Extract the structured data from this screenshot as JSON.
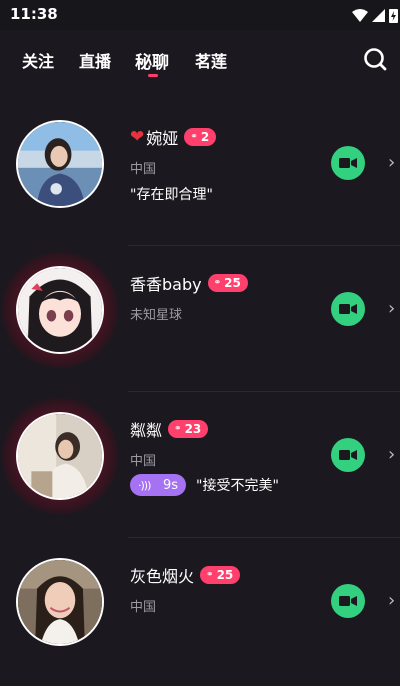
{
  "status_bar": {
    "time": "11:38",
    "icons": [
      "wifi-icon",
      "signal-icon",
      "battery-charging-icon"
    ]
  },
  "tabs": [
    {
      "label": "关注",
      "active": false
    },
    {
      "label": "直播",
      "active": false
    },
    {
      "label": "秘聊",
      "active": true
    },
    {
      "label": "茗莲",
      "active": false
    }
  ],
  "accent_color": "#ff3c6f",
  "users": [
    {
      "has_heart": true,
      "name": "婉娅",
      "level": "2",
      "location": "中国",
      "signature": "\"存在即合理\"",
      "voice": "",
      "live_ripple": false
    },
    {
      "has_heart": false,
      "name": "香香baby",
      "level": "25",
      "location": "未知星球",
      "signature": "",
      "voice": "",
      "live_ripple": true
    },
    {
      "has_heart": false,
      "name": "粼粼",
      "level": "23",
      "location": "中国",
      "signature": "\"接受不完美\"",
      "voice": "9s",
      "live_ripple": true
    },
    {
      "has_heart": false,
      "name": "灰色烟火",
      "level": "25",
      "location": "中国",
      "signature": "",
      "voice": "",
      "live_ripple": false
    }
  ]
}
